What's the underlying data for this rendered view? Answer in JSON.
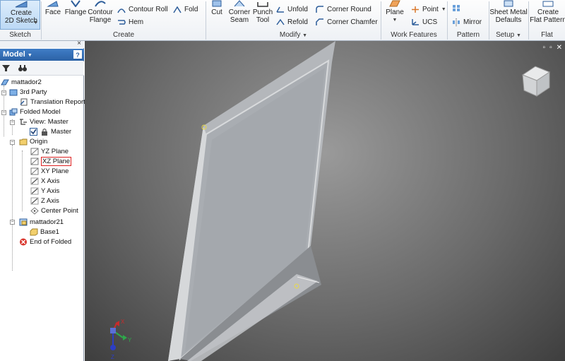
{
  "ribbon": {
    "sketch_panel": {
      "create_2d_sketch": "Create\n2D Sketch",
      "label": "Sketch"
    },
    "create_panel": {
      "label": "Create",
      "face": "Face",
      "flange": "Flange",
      "contour_flange": "Contour\nFlange",
      "contour_roll": "Contour Roll",
      "hem": "Hem",
      "fold": "Fold"
    },
    "modify_panel": {
      "label": "Modify",
      "cut": "Cut",
      "corner_seam": "Corner\nSeam",
      "punch_tool": "Punch\nTool",
      "unfold": "Unfold",
      "refold": "Refold",
      "corner_round": "Corner Round",
      "corner_chamfer": "Corner Chamfer"
    },
    "work_features_panel": {
      "label": "Work Features",
      "plane": "Plane",
      "point": "Point",
      "ucs": "UCS"
    },
    "pattern_panel": {
      "label": "Pattern",
      "mirror": "Mirror"
    },
    "setup_panel": {
      "label": "Setup",
      "sheet_metal_defaults": "Sheet Metal\nDefaults"
    },
    "flat_pattern_panel": {
      "label": "Flat Pattern",
      "create_flat_pattern": "Create\nFlat Pattern"
    },
    "colors": {
      "accent": "#2c62a6",
      "ribbon_bg": "#eef1f5"
    }
  },
  "browser": {
    "title": "Model",
    "help": "?",
    "close": "×",
    "tree": [
      {
        "label": "mattador2",
        "icon": "part-icon"
      },
      {
        "label": "3rd Party",
        "icon": "folder-icon"
      },
      {
        "label": "Translation Report",
        "icon": "report-icon"
      },
      {
        "label": "Folded Model",
        "icon": "folded-model-icon"
      },
      {
        "label": "View: Master",
        "icon": "view-icon"
      },
      {
        "label": "Master",
        "icon": "lock-icon"
      },
      {
        "label": "Origin",
        "icon": "folder-icon"
      },
      {
        "label": "YZ Plane",
        "icon": "plane-icon"
      },
      {
        "label": "XZ Plane",
        "icon": "plane-icon"
      },
      {
        "label": "XY Plane",
        "icon": "plane-icon"
      },
      {
        "label": "X Axis",
        "icon": "axis-icon"
      },
      {
        "label": "Y Axis",
        "icon": "axis-icon"
      },
      {
        "label": "Z Axis",
        "icon": "axis-icon"
      },
      {
        "label": "Center Point",
        "icon": "point-icon"
      },
      {
        "label": "mattador21",
        "icon": "solid-icon"
      },
      {
        "label": "Base1",
        "icon": "feature-icon"
      },
      {
        "label": "End of Folded",
        "icon": "end-icon"
      }
    ]
  },
  "viewport": {
    "triad": {
      "x": "X",
      "y": "Y",
      "z": "Z"
    }
  }
}
